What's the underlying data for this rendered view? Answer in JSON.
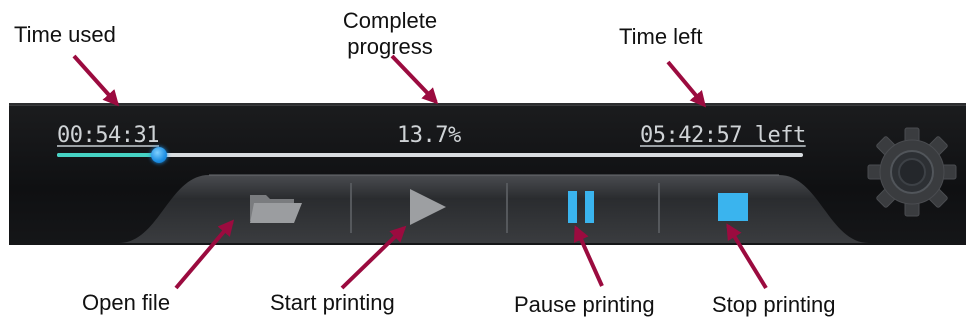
{
  "annotations": {
    "time_used": "Time used",
    "complete_progress": "Complete progress",
    "time_left": "Time left",
    "open_file": "Open file",
    "start_printing": "Start printing",
    "pause_printing": "Pause printing",
    "stop_printing": "Stop printing"
  },
  "status": {
    "time_used": "00:54:31",
    "progress_text": "13.7%",
    "progress_fraction": 0.137,
    "time_left": "05:42:57 left"
  },
  "buttons": [
    {
      "name": "open-file",
      "icon": "folder-icon"
    },
    {
      "name": "start-printing",
      "icon": "play-icon"
    },
    {
      "name": "pause-printing",
      "icon": "pause-icon"
    },
    {
      "name": "stop-printing",
      "icon": "stop-icon"
    }
  ],
  "settings": {
    "icon": "gear-icon"
  },
  "colors": {
    "arrow": "#9b0b3f",
    "accent_blue": "#3ab4ee",
    "progress_fill": "#46d3c4",
    "panel_bg": "#121315"
  }
}
